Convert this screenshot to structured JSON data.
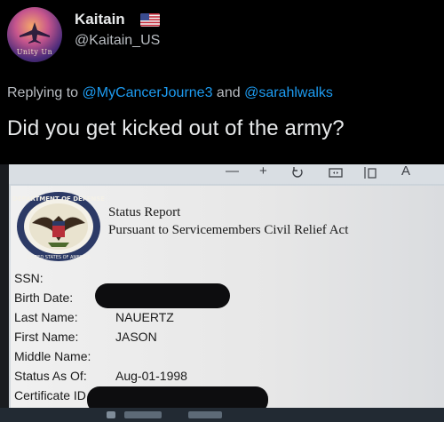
{
  "tweet": {
    "display_name": "Kaitain",
    "handle": "@Kaitain_US",
    "avatar_text": "Unity Un",
    "flag_icon": "us-flag-icon",
    "reply_prefix": "Replying to",
    "reply_mention_1": "@MyCancerJourne3",
    "reply_and": "and",
    "reply_mention_2": "@sarahlwalks",
    "text": "Did you get kicked out of the army?"
  },
  "colors": {
    "background": "#000000",
    "text": "#e7e9ea",
    "secondary_text": "#b8bcc1",
    "mention": "#1d9bf0",
    "redaction": "#0d0d0f"
  },
  "viewer_toolbar": {
    "icons": [
      "minus-icon",
      "plus-icon",
      "rotate-icon",
      "fit-page-icon",
      "page-view-icon",
      "text-size-icon"
    ],
    "zoom_out": "—",
    "zoom_in": "+",
    "text_size": "A"
  },
  "document": {
    "seal_label": "DEPARTMENT OF DEFENSE",
    "seal_bottom_text": "UNITED STATES OF AMERICA",
    "title": "Status Report",
    "subtitle": "Pursuant to Servicemembers Civil Relief Act",
    "fields": [
      {
        "label": "SSN:",
        "value": ""
      },
      {
        "label": "Birth Date:",
        "value": ""
      },
      {
        "label": "Last Name:",
        "value": "NAUERTZ"
      },
      {
        "label": "First Name:",
        "value": "JASON"
      },
      {
        "label": "Middle Name:",
        "value": ""
      },
      {
        "label": "Status As Of:",
        "value": "Aug-01-1998"
      },
      {
        "label": "Certificate ID",
        "value": ""
      }
    ],
    "redacted_fields": [
      "Birth Date",
      "Certificate ID"
    ]
  }
}
